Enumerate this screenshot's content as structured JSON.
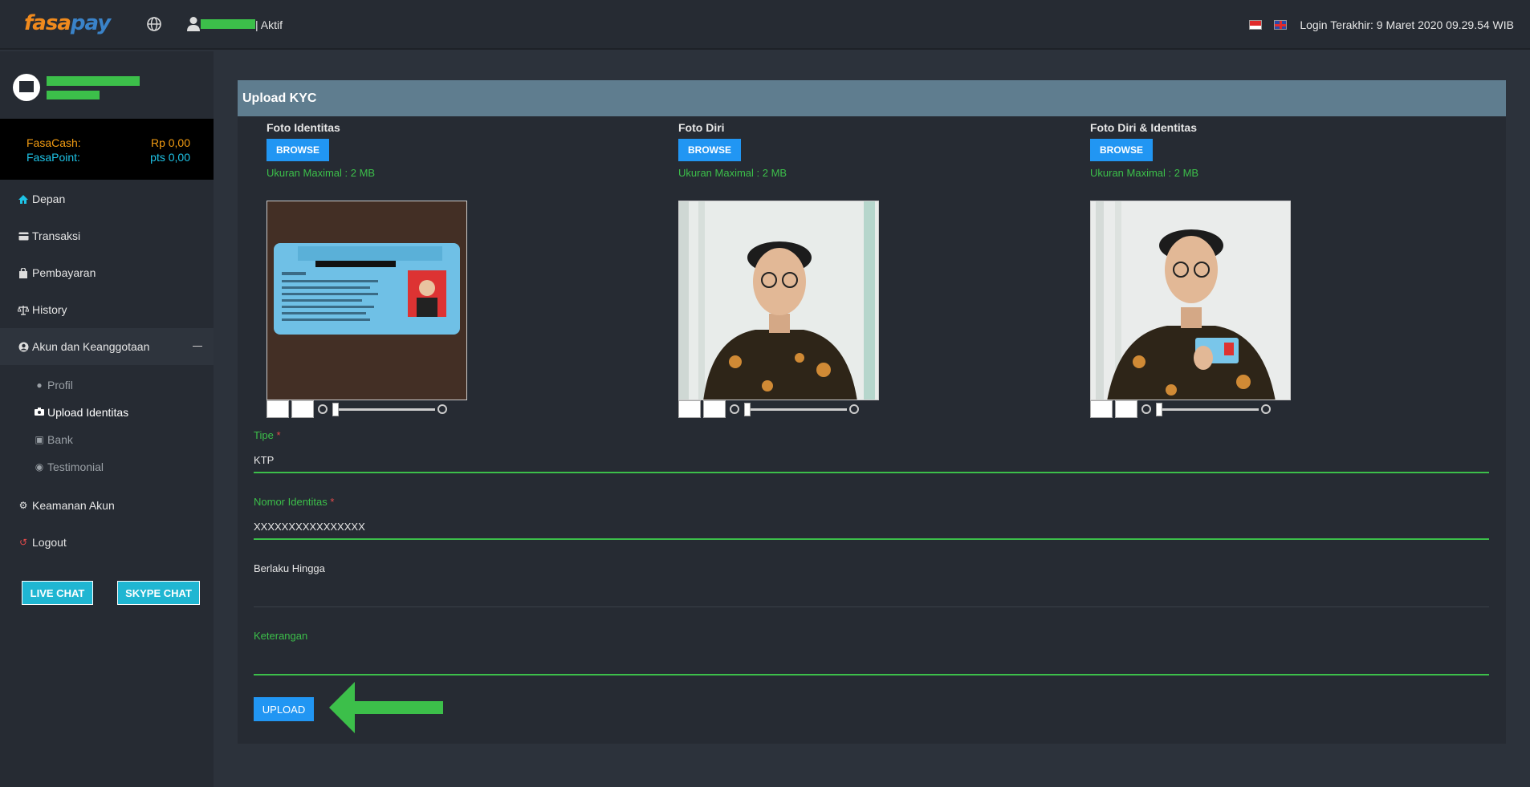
{
  "header": {
    "logo_fasa": "fasa",
    "logo_pay": "pay",
    "user_status": "| Aktif",
    "last_login": "Login Terakhir: 9 Maret 2020 09.29.54 WIB"
  },
  "sidebar": {
    "balances": {
      "cash_label": "FasaCash:",
      "cash_value": "Rp 0,00",
      "point_label": "FasaPoint:",
      "point_value": "pts 0,00"
    },
    "nav": [
      {
        "label": "Depan",
        "icon": "home-icon"
      },
      {
        "label": "Transaksi",
        "icon": "card-icon"
      },
      {
        "label": "Pembayaran",
        "icon": "bag-icon"
      },
      {
        "label": "History",
        "icon": "balance-scale-icon"
      },
      {
        "label": "Akun dan Keanggotaan",
        "icon": "user-circle-icon"
      },
      {
        "label": "Keamanan Akun",
        "icon": "gear-icon"
      },
      {
        "label": "Logout",
        "icon": "logout-icon"
      }
    ],
    "subnav": [
      {
        "label": "Profil",
        "icon": "user-icon"
      },
      {
        "label": "Upload Identitas",
        "icon": "camera-icon"
      },
      {
        "label": "Bank",
        "icon": "bank-icon"
      },
      {
        "label": "Testimonial",
        "icon": "comment-icon"
      }
    ],
    "live_chat": "LIVE CHAT",
    "skype_chat": "SKYPE CHAT"
  },
  "main": {
    "title": "Upload KYC",
    "uploads": [
      {
        "label": "Foto Identitas",
        "browse": "BROWSE",
        "note": "Ukuran Maximal : 2 MB"
      },
      {
        "label": "Foto Diri",
        "browse": "BROWSE",
        "note": "Ukuran Maximal : 2 MB"
      },
      {
        "label": "Foto Diri & Identitas",
        "browse": "BROWSE",
        "note": "Ukuran Maximal : 2 MB"
      }
    ],
    "form": {
      "tipe_label": "Tipe",
      "tipe_value": "KTP",
      "nomor_label": "Nomor Identitas",
      "nomor_value": "XXXXXXXXXXXXXXXX",
      "berlaku_label": "Berlaku Hingga",
      "keterangan_label": "Keterangan",
      "required_mark": "*"
    },
    "upload_button": "UPLOAD"
  },
  "colors": {
    "accent_blue": "#2196f3",
    "success_green": "#3cbf4a",
    "header_steel": "#5f7d8f",
    "cash_orange": "#f39c12",
    "point_cyan": "#1ec3e6"
  }
}
